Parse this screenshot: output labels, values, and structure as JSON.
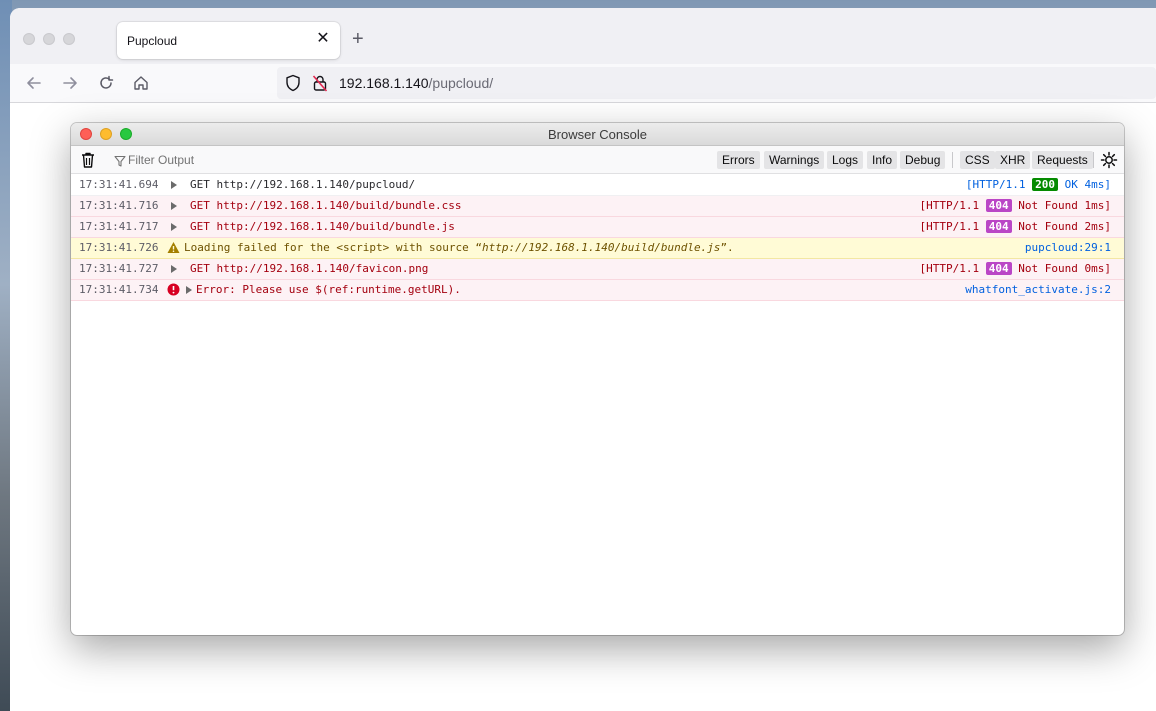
{
  "browser": {
    "tab_title": "Pupcloud",
    "tab_close": "✕",
    "new_tab": "+",
    "url_host": "192.168.1.140",
    "url_path": "/pupcloud/"
  },
  "console": {
    "title": "Browser Console",
    "filter_placeholder": "Filter Output",
    "filters": {
      "errors": "Errors",
      "warnings": "Warnings",
      "logs": "Logs",
      "info": "Info",
      "debug": "Debug",
      "css": "CSS",
      "xhr": "XHR",
      "requests": "Requests"
    },
    "rows": [
      {
        "ts": "17:31:41.694",
        "method": "GET",
        "url": "http://192.168.1.140/pupcloud/",
        "proto": "[HTTP/1.1",
        "code": "200",
        "status": "OK 4ms]"
      },
      {
        "ts": "17:31:41.716",
        "method": "GET",
        "url": "http://192.168.1.140/build/bundle.css",
        "proto": "[HTTP/1.1",
        "code": "404",
        "status": "Not Found 1ms]"
      },
      {
        "ts": "17:31:41.717",
        "method": "GET",
        "url": "http://192.168.1.140/build/bundle.js",
        "proto": "[HTTP/1.1",
        "code": "404",
        "status": "Not Found 2ms]"
      },
      {
        "ts": "17:31:41.726",
        "msg_pre": "Loading failed for the <script> with source “",
        "msg_url": "http://192.168.1.140/build/bundle.js",
        "msg_post": "”.",
        "source": "pupcloud:29:1"
      },
      {
        "ts": "17:31:41.727",
        "method": "GET",
        "url": "http://192.168.1.140/favicon.png",
        "proto": "[HTTP/1.1",
        "code": "404",
        "status": "Not Found 0ms]"
      },
      {
        "ts": "17:31:41.734",
        "msg": "Error: Please use $(ref:runtime.getURL).",
        "source": "whatfont_activate.js:2"
      }
    ]
  },
  "colors": {
    "error_bg": "#fdf2f5",
    "warning_bg": "#fffbd6",
    "ok_badge": "#058b00",
    "notfound_badge": "#ba46c6",
    "link": "#0060df"
  }
}
